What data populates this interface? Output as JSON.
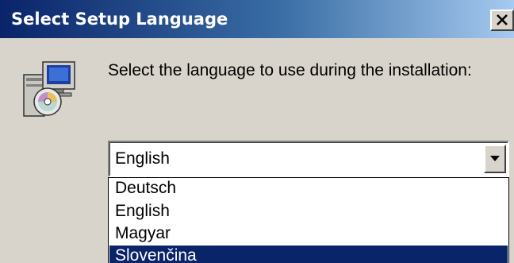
{
  "window": {
    "title": "Select Setup Language",
    "close_label": "Close"
  },
  "dialog": {
    "prompt": "Select the language to use during the installation:",
    "icon": "setup-computer-cd-icon"
  },
  "language_select": {
    "selected_value": "English",
    "options": [
      {
        "label": "Deutsch",
        "highlighted": false
      },
      {
        "label": "English",
        "highlighted": false
      },
      {
        "label": "Magyar",
        "highlighted": false
      },
      {
        "label": "Slovenčina",
        "highlighted": true
      }
    ]
  },
  "colors": {
    "titlebar_start": "#0a246a",
    "titlebar_end": "#a6caf0",
    "face": "#d8d4cc",
    "highlight": "#0a246a"
  }
}
